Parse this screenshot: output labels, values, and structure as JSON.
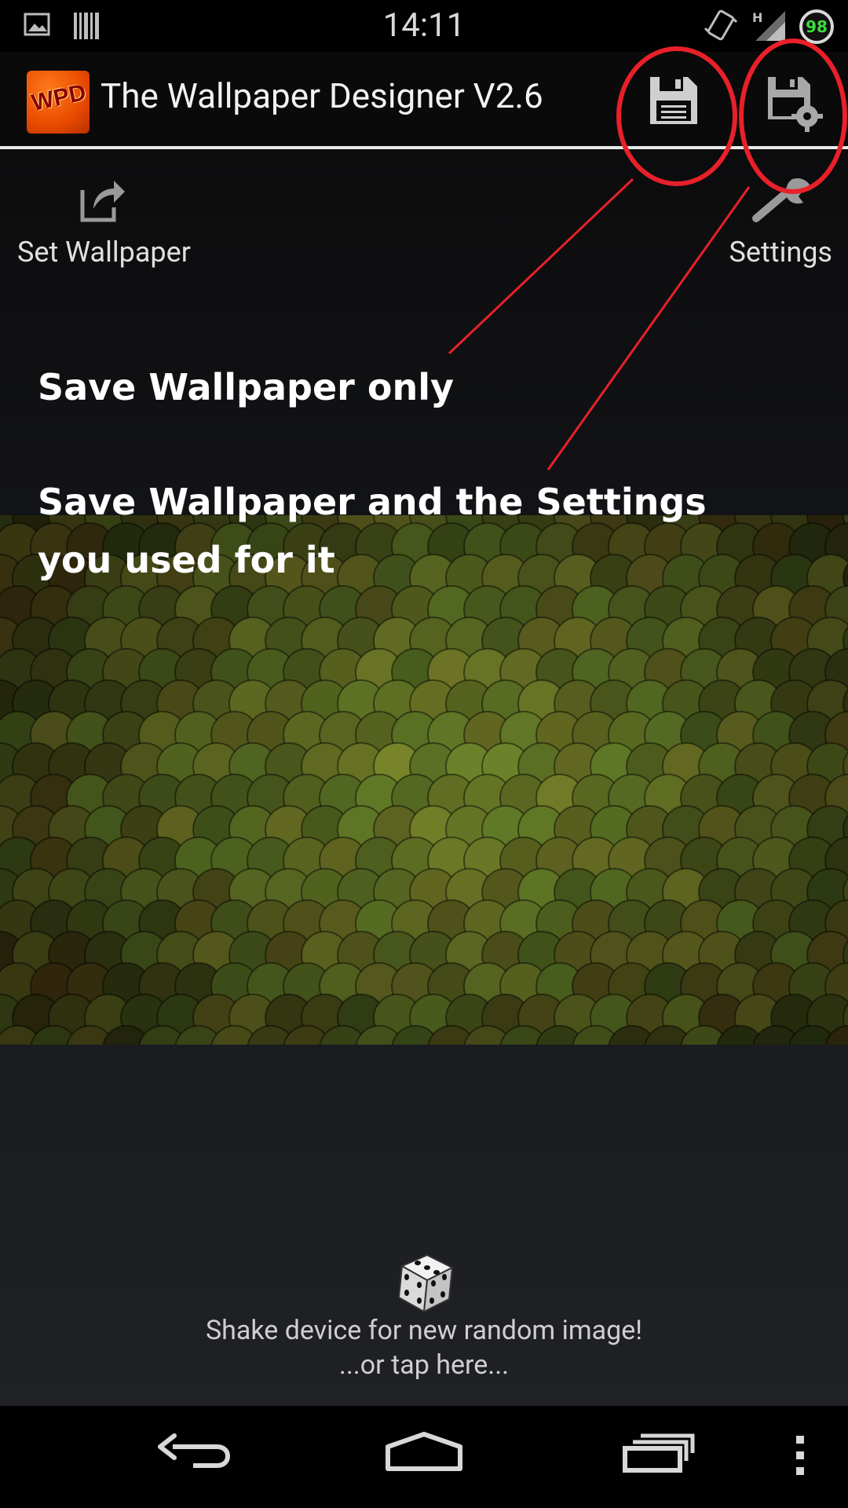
{
  "status_bar": {
    "time": "14:11",
    "icons": [
      "image-notification-icon",
      "barcode-notification-icon",
      "vibrate-icon",
      "signal-icon",
      "battery-icon"
    ],
    "network_type": "H",
    "battery_level": "98"
  },
  "action_bar": {
    "app_logo_text": "WPD",
    "title": "The Wallpaper Designer V2.6",
    "save_wallpaper_icon": "floppy-disk-icon",
    "save_with_settings_icon": "floppy-disk-gear-icon"
  },
  "top_actions": {
    "set_wallpaper_label": "Set Wallpaper",
    "settings_label": "Settings"
  },
  "annotations": {
    "save_only": "Save Wallpaper only",
    "save_with_settings_line1": "Save Wallpaper and the Settings",
    "save_with_settings_line2": "you used for it",
    "highlight_color": "#e8202a"
  },
  "random": {
    "line1": "Shake device for new random image!",
    "line2": "...or tap here..."
  },
  "nav_bar": {
    "icons": [
      "back-icon",
      "home-icon",
      "recent-apps-icon",
      "overflow-menu-icon"
    ]
  },
  "colors": {
    "battery_text": "#3cdc3c",
    "wallpaper_base": "#4a5524",
    "annotation_red": "#e8202a"
  }
}
